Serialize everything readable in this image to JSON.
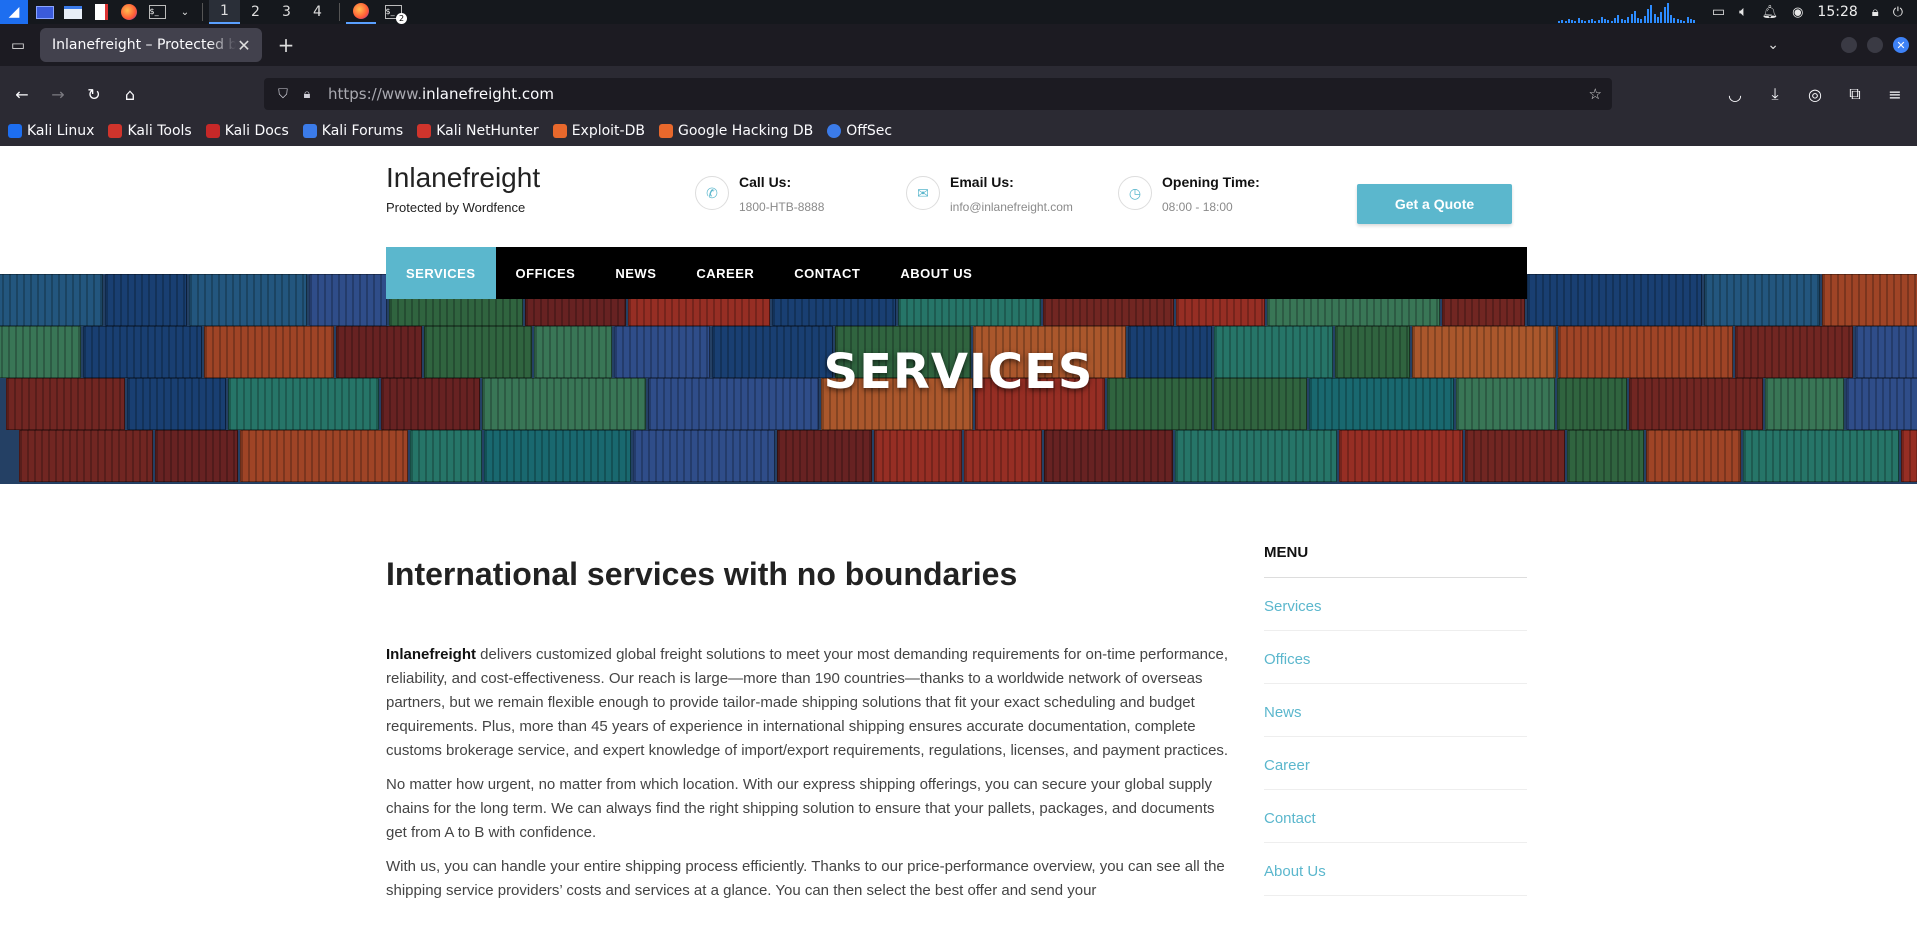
{
  "taskbar": {
    "workspaces": [
      "1",
      "2",
      "3",
      "4"
    ],
    "active_workspace": "1",
    "terminal_badge": "2",
    "clock": "15:28"
  },
  "browser": {
    "tab_title": "Inlanefreight – Protected by Wordfence",
    "url_scheme": "https://www.",
    "url_host": "inlanefreight.com",
    "bookmarks": [
      {
        "label": "Kali Linux",
        "color": "#1d6ef0"
      },
      {
        "label": "Kali Tools",
        "color": "#d0342c"
      },
      {
        "label": "Kali Docs",
        "color": "#c62828"
      },
      {
        "label": "Kali Forums",
        "color": "#3b7be9"
      },
      {
        "label": "Kali NetHunter",
        "color": "#d0342c"
      },
      {
        "label": "Exploit-DB",
        "color": "#e8682c"
      },
      {
        "label": "Google Hacking DB",
        "color": "#e8682c"
      },
      {
        "label": "OffSec",
        "color": "#3b7be9"
      }
    ]
  },
  "site": {
    "brand": "Inlanefreight",
    "brand_sub": "Protected by Wordfence",
    "contacts": [
      {
        "label": "Call Us:",
        "value": "1800-HTB-8888",
        "icon": "phone-icon"
      },
      {
        "label": "Email Us:",
        "value": "info@inlanefreight.com",
        "icon": "envelope-icon"
      },
      {
        "label": "Opening Time:",
        "value": "08:00 - 18:00",
        "icon": "clock-icon"
      }
    ],
    "quote_button": "Get a Quote",
    "menu": [
      "SERVICES",
      "OFFICES",
      "NEWS",
      "CAREER",
      "CONTACT",
      "ABOUT US"
    ],
    "active_menu": "SERVICES",
    "hero_title": "SERVICES",
    "accent_color": "#5bb7cd",
    "heading": "International services with no boundaries",
    "para1_bold": "Inlanefreight",
    "para1_rest": " delivers customized global freight solutions to meet your most demanding requirements for on-time performance, reliability, and cost-effectiveness. Our reach is large—more than 190 countries—thanks to a worldwide network of overseas partners, but we remain flexible enough to provide tailor-made shipping solutions that fit your exact scheduling and budget requirements. Plus, more than 45 years of experience in international shipping ensures accurate documentation, complete customs brokerage service, and expert knowledge of import/export requirements, regulations, licenses, and payment practices.",
    "para2": "No matter how urgent, no matter from which location. With our express shipping offerings, you can secure your global supply chains for the long term. We can always find the right shipping solution to ensure that your pallets, packages, and documents get from A to B with confidence.",
    "para3": "With us, you can handle your entire shipping process efficiently. Thanks to our price-performance overview, you can see all the shipping service providers’ costs and services at a glance. You can then select the best offer and send your",
    "sidebar_title": "MENU",
    "sidebar_items": [
      "Services",
      "Offices",
      "News",
      "Career",
      "Contact",
      "About Us"
    ]
  }
}
